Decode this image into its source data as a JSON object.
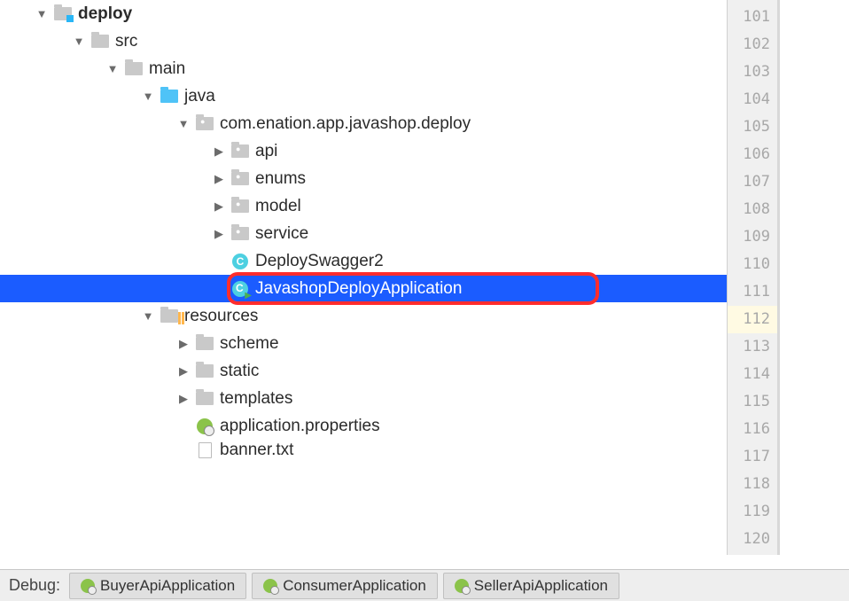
{
  "tree": [
    {
      "indent": 38,
      "arrow": "down",
      "icon": "folder-module",
      "label": "deploy",
      "bold": true
    },
    {
      "indent": 80,
      "arrow": "down",
      "icon": "folder-gray",
      "label": "src"
    },
    {
      "indent": 118,
      "arrow": "down",
      "icon": "folder-gray",
      "label": "main"
    },
    {
      "indent": 158,
      "arrow": "down",
      "icon": "folder-blue",
      "label": "java"
    },
    {
      "indent": 198,
      "arrow": "down",
      "icon": "folder-package",
      "label": "com.enation.app.javashop.deploy"
    },
    {
      "indent": 238,
      "arrow": "right",
      "icon": "folder-package",
      "label": "api"
    },
    {
      "indent": 238,
      "arrow": "right",
      "icon": "folder-package",
      "label": "enums"
    },
    {
      "indent": 238,
      "arrow": "right",
      "icon": "folder-package",
      "label": "model"
    },
    {
      "indent": 238,
      "arrow": "right",
      "icon": "folder-package",
      "label": "service"
    },
    {
      "indent": 238,
      "arrow": "none",
      "icon": "class",
      "label": "DeploySwagger2"
    },
    {
      "indent": 238,
      "arrow": "none",
      "icon": "class-main",
      "label": "JavashopDeployApplication",
      "selected": true,
      "callout": true
    },
    {
      "indent": 158,
      "arrow": "down",
      "icon": "folder-resources",
      "label": "resources"
    },
    {
      "indent": 198,
      "arrow": "right",
      "icon": "folder-gray",
      "label": "scheme"
    },
    {
      "indent": 198,
      "arrow": "right",
      "icon": "folder-gray",
      "label": "static"
    },
    {
      "indent": 198,
      "arrow": "right",
      "icon": "folder-gray",
      "label": "templates"
    },
    {
      "indent": 198,
      "arrow": "none",
      "icon": "spring",
      "label": "application.properties"
    },
    {
      "indent": 198,
      "arrow": "none",
      "icon": "file",
      "label": "banner.txt",
      "clipped": true
    }
  ],
  "gutter": {
    "start": 101,
    "end": 120,
    "current": 112
  },
  "debug": {
    "label": "Debug:",
    "tabs": [
      "BuyerApiApplication",
      "ConsumerApplication",
      "SellerApiApplication"
    ]
  }
}
